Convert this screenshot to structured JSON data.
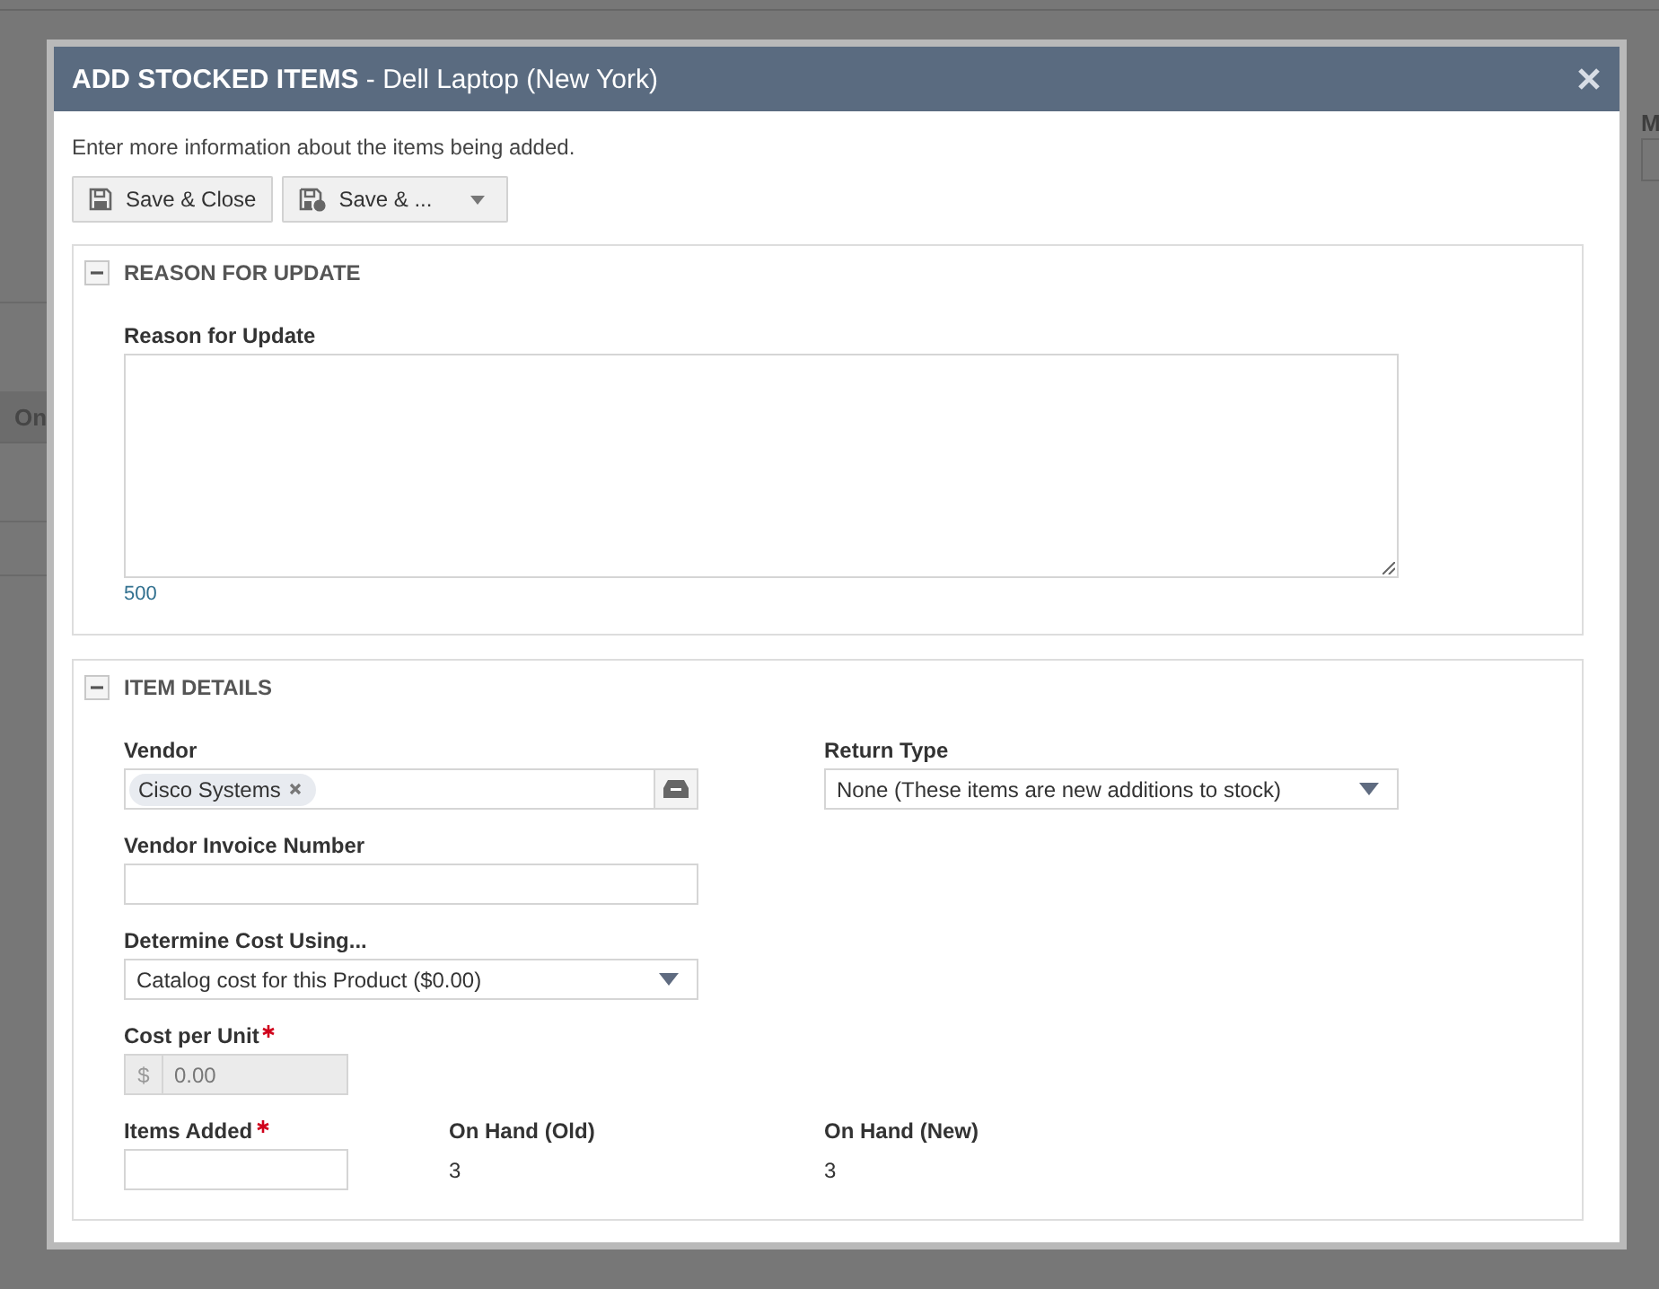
{
  "background": {
    "texts": [
      "On",
      "M"
    ]
  },
  "dialog": {
    "title": "ADD STOCKED ITEMS",
    "subtitle": "- Dell Laptop (New York)",
    "intro": "Enter more information about the items being added.",
    "toolbar": [
      {
        "kind": "button",
        "label": "Save & Close"
      },
      {
        "kind": "split",
        "label": "Save & ..."
      }
    ],
    "sections": [
      {
        "title": "REASON FOR UPDATE",
        "expanded": true,
        "rows": [
          [
            {
              "kind": "textarea",
              "label": "Reason for Update",
              "required": false,
              "counter": "500"
            }
          ]
        ]
      },
      {
        "title": "ITEM DETAILS",
        "expanded": true,
        "rows": [
          [
            {
              "kind": "tags",
              "label": "Vendor",
              "required": false,
              "tags": [
                "Cisco Systems"
              ]
            },
            "",
            {
              "kind": "select",
              "label": "Return Type",
              "required": false,
              "value": "None (These items are new additions to stock)"
            }
          ],
          [
            {
              "kind": "text",
              "label": "Vendor Invoice Number",
              "required": false
            }
          ],
          [
            {
              "kind": "select",
              "label": "Determine Cost Using...",
              "required": false,
              "value": "Catalog cost for this Product ($0.00)"
            }
          ],
          [
            {
              "kind": "currency",
              "label": "Cost per Unit",
              "required": true,
              "disabled": true,
              "prefix": "$",
              "value": "0.00"
            }
          ],
          [
            {
              "kind": "number",
              "label": "Items Added",
              "required": true
            },
            {
              "kind": "readonly",
              "label": "On Hand (Old)",
              "value": "3"
            },
            {
              "kind": "readonly",
              "label": "On Hand (New)",
              "value": "3"
            }
          ]
        ]
      }
    ]
  }
}
